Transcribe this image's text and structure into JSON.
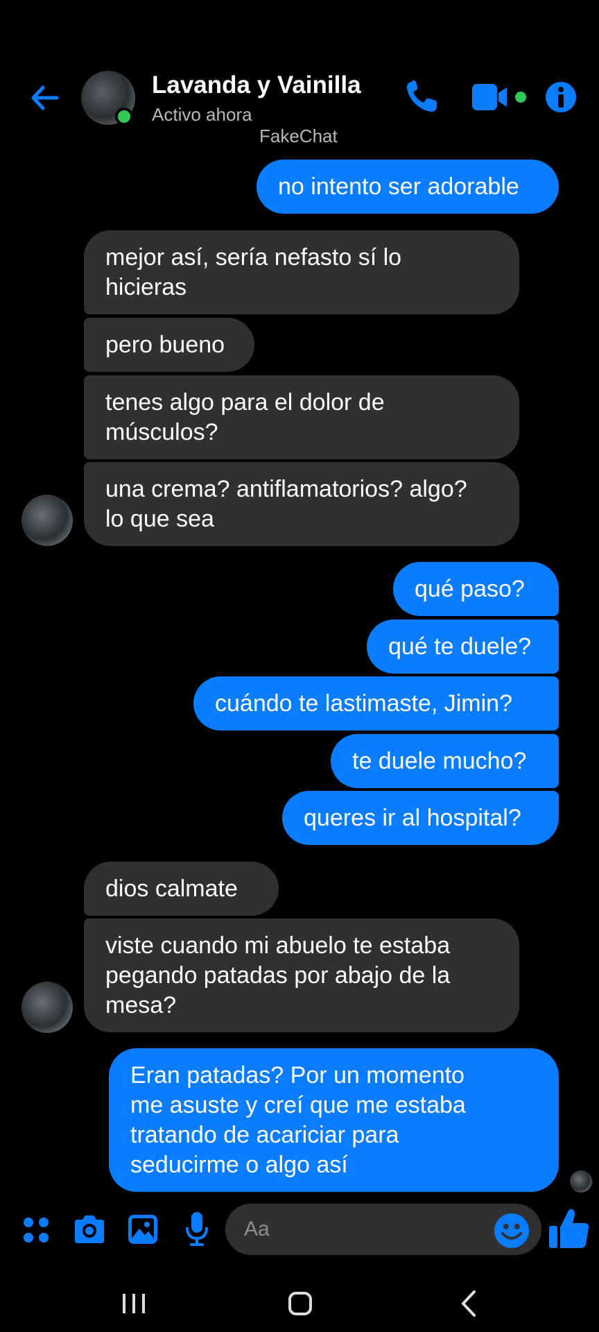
{
  "header": {
    "contact_name": "Lavanda y Vainilla",
    "status": "Activo ahora",
    "watermark": "FakeChat"
  },
  "colors": {
    "accent": "#0a7cff",
    "received_bubble": "#303030",
    "online": "#31c95a",
    "background": "#000000"
  },
  "messages": [
    {
      "direction": "sent",
      "text": "no intento ser adorable"
    },
    {
      "direction": "received",
      "lines": [
        "mejor así, sería nefasto sí lo",
        "hicieras"
      ]
    },
    {
      "direction": "received",
      "text": "pero bueno"
    },
    {
      "direction": "received",
      "lines": [
        "tenes algo para el dolor de",
        "músculos?"
      ]
    },
    {
      "direction": "received",
      "lines": [
        "una crema? antiflamatorios? algo?",
        "lo que sea"
      ]
    },
    {
      "direction": "sent",
      "text": "qué paso?"
    },
    {
      "direction": "sent",
      "text": "qué te duele?"
    },
    {
      "direction": "sent",
      "text": "cuándo te lastimaste, Jimin?"
    },
    {
      "direction": "sent",
      "text": "te duele mucho?"
    },
    {
      "direction": "sent",
      "text": "queres ir al hospital?"
    },
    {
      "direction": "received",
      "text": "dios calmate"
    },
    {
      "direction": "received",
      "lines": [
        "viste cuando mi abuelo te estaba",
        "pegando patadas por abajo de la",
        "mesa?"
      ]
    },
    {
      "direction": "sent",
      "lines": [
        "Eran patadas? Por un momento",
        "me asuste y creí que me estaba",
        "tratando de acariciar para",
        "seducirme o algo así"
      ]
    }
  ],
  "composer": {
    "placeholder": "Aa",
    "icons": [
      "menu-dots-icon",
      "camera-icon",
      "gallery-icon",
      "microphone-icon",
      "emoji-icon",
      "thumbs-up-icon"
    ]
  },
  "header_icons": [
    "back-arrow-icon",
    "phone-icon",
    "video-camera-icon",
    "info-icon"
  ],
  "navbar_icons": [
    "recent-apps-icon",
    "home-icon",
    "back-nav-icon"
  ]
}
